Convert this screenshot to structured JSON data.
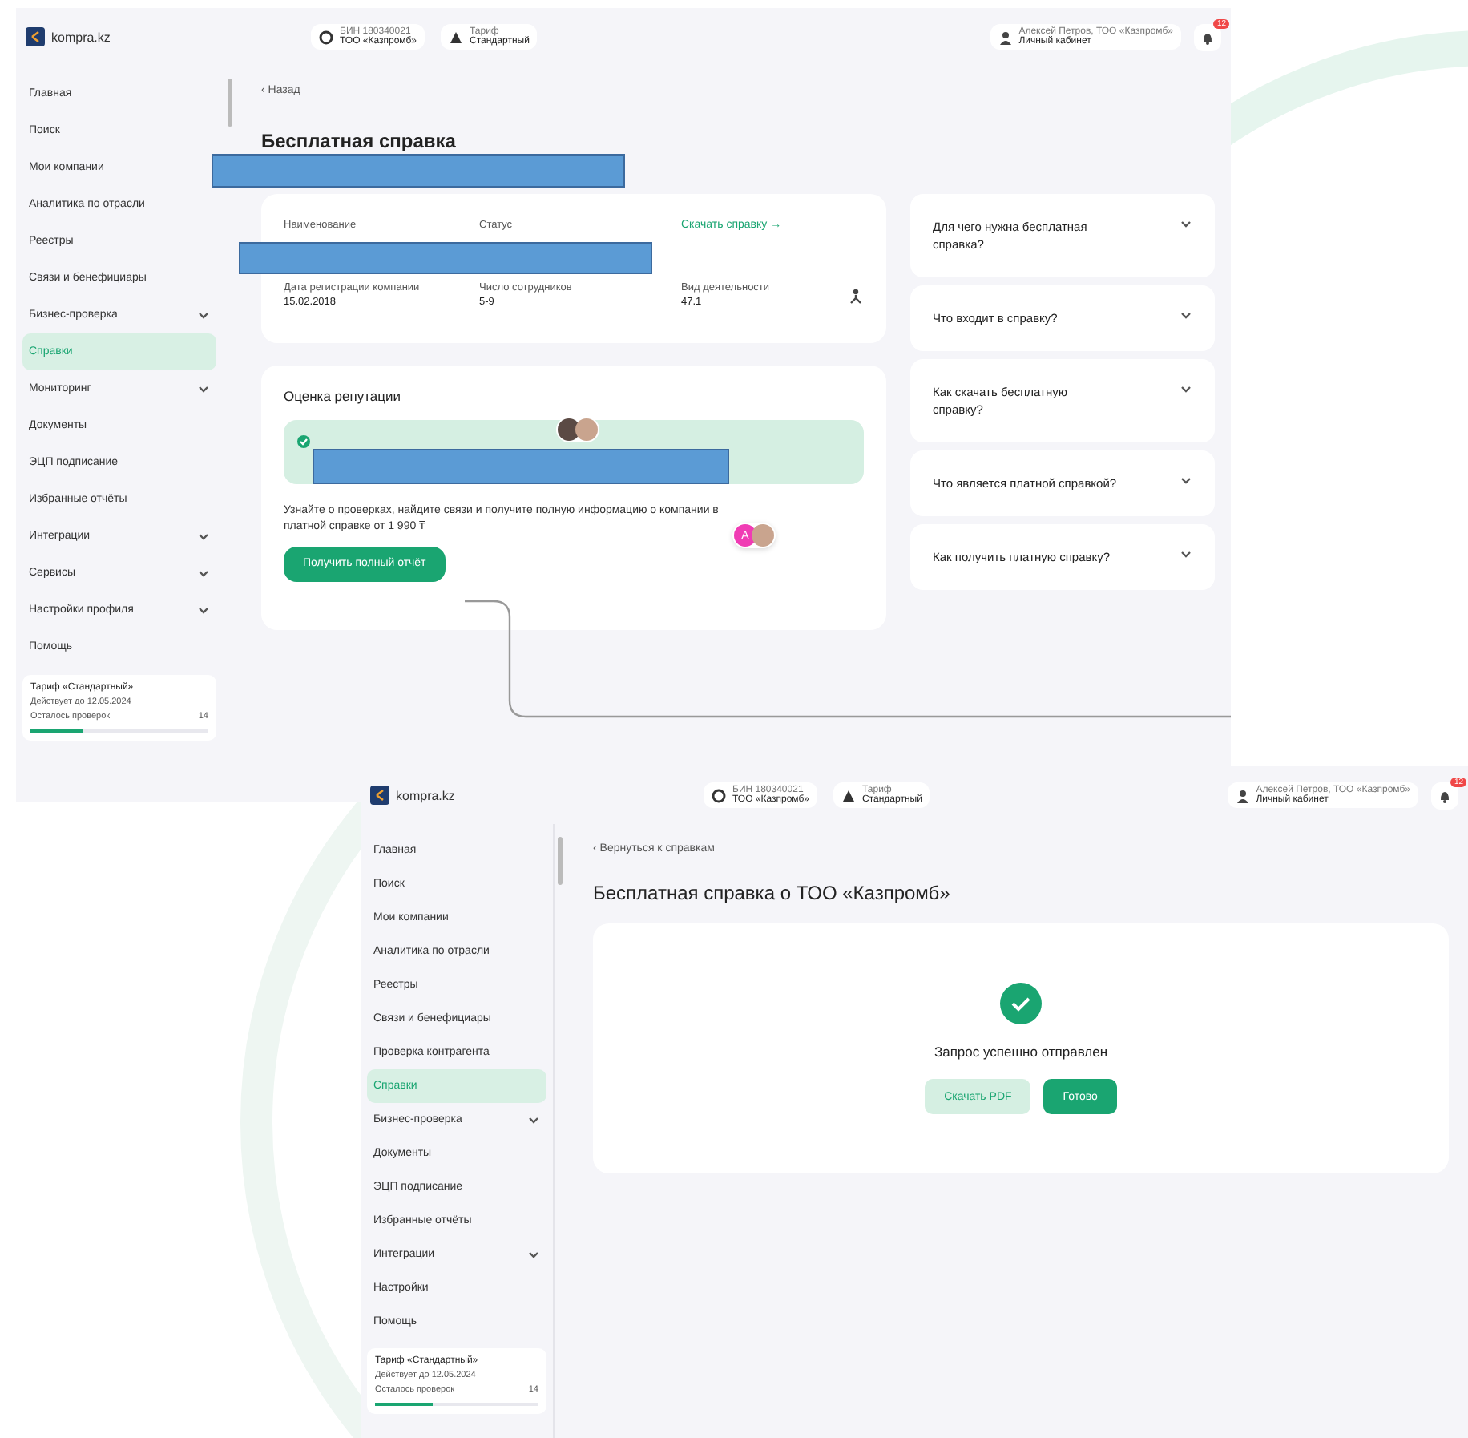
{
  "windows": [
    {
      "header": {
        "logo": "kompra.kz",
        "pills": [
          {
            "line1": "БИН 180340021",
            "line2": "ТОО «Казпромб»"
          },
          {
            "line1": "Тариф",
            "line2": "Стандартный"
          }
        ],
        "user": {
          "line1": "Алексей Петров, ТОО «Казпромб»",
          "line2": "Личный кабинет"
        },
        "badge": "12"
      },
      "sidebar": {
        "items": [
          {
            "label": "Главная",
            "selected": false,
            "has_children": false
          },
          {
            "label": "Поиск",
            "selected": false,
            "has_children": false
          },
          {
            "label": "Мои компании",
            "selected": false,
            "has_children": false
          },
          {
            "label": "Аналитика по отрасли",
            "selected": false,
            "has_children": false
          },
          {
            "label": "Реестры",
            "selected": false,
            "has_children": false
          },
          {
            "label": "Связи и бенефициары",
            "selected": false,
            "has_children": false
          },
          {
            "label": "Бизнес-проверка",
            "selected": false,
            "has_children": true
          },
          {
            "label": "Справки",
            "selected": true,
            "has_children": false
          },
          {
            "label": "Мониторинг",
            "selected": false,
            "has_children": true
          },
          {
            "label": "Документы",
            "selected": false,
            "has_children": false
          },
          {
            "label": "ЭЦП подписание",
            "selected": false,
            "has_children": false
          },
          {
            "label": "Избранные отчёты",
            "selected": false,
            "has_children": false
          },
          {
            "label": "Интеграции",
            "selected": false,
            "has_children": true
          },
          {
            "label": "Сервисы",
            "selected": false,
            "has_children": true
          },
          {
            "label": "Настройки профиля",
            "selected": false,
            "has_children": true
          },
          {
            "label": "Помощь",
            "selected": false,
            "has_children": false
          }
        ],
        "plan": {
          "title": "Тариф «Стандартный»",
          "text": "Действует до 12.05.2024",
          "label": "Осталось проверок",
          "count": "14",
          "level": 0.3
        }
      },
      "main": {
        "back": "‹ Назад",
        "title": "Бесплатная справка",
        "summary": {
          "labels": [
            "Наименование",
            "Статус"
          ],
          "link": "Скачать справку →",
          "fields": [
            {
              "label": "Дата регистрации компании",
              "value": "15.02.2018"
            },
            {
              "label": "Число сотрудников",
              "value": "5-9"
            },
            {
              "label": "Вид деятельности",
              "value": "47.1"
            }
          ]
        },
        "reputation": {
          "title": "Оценка репутации",
          "badge_letter": "А",
          "text": "Узнайте о проверках, найдите связи и получите полную информацию о компании в платной справке от 1 990 ₸",
          "button": "Получить полный отчёт"
        },
        "faq": [
          "Для чего нужна бесплатная справка?",
          "Что входит в справку?",
          "Как скачать бесплатную справку?",
          "Что является платной справкой?",
          "Как получить платную справку?"
        ]
      }
    },
    {
      "header": {
        "logo": "kompra.kz",
        "pills": [
          {
            "line1": "БИН 180340021",
            "line2": "ТОО «Казпромб»"
          },
          {
            "line1": "Тариф",
            "line2": "Стандартный"
          }
        ],
        "user": {
          "line1": "Алексей Петров, ТОО «Казпромб»",
          "line2": "Личный кабинет"
        },
        "badge": "12"
      },
      "sidebar": {
        "items": [
          {
            "label": "Главная",
            "selected": false,
            "has_children": false
          },
          {
            "label": "Поиск",
            "selected": false,
            "has_children": false
          },
          {
            "label": "Мои компании",
            "selected": false,
            "has_children": false
          },
          {
            "label": "Аналитика по отрасли",
            "selected": false,
            "has_children": false
          },
          {
            "label": "Реестры",
            "selected": false,
            "has_children": false
          },
          {
            "label": "Связи и бенефициары",
            "selected": false,
            "has_children": false
          },
          {
            "label": "Проверка контрагента",
            "selected": false,
            "has_children": false
          },
          {
            "label": "Справки",
            "selected": true,
            "has_children": false
          },
          {
            "label": "Бизнес-проверка",
            "selected": false,
            "has_children": true
          },
          {
            "label": "Документы",
            "selected": false,
            "has_children": false
          },
          {
            "label": "ЭЦП подписание",
            "selected": false,
            "has_children": false
          },
          {
            "label": "Избранные отчёты",
            "selected": false,
            "has_children": false
          },
          {
            "label": "Интеграции",
            "selected": false,
            "has_children": true
          },
          {
            "label": "Настройки",
            "selected": false,
            "has_children": false
          },
          {
            "label": "Помощь",
            "selected": false,
            "has_children": false
          }
        ],
        "plan": {
          "title": "Тариф «Стандартный»",
          "text": "Действует до 12.05.2024",
          "label": "Осталось проверок",
          "count": "14",
          "level": 0.35
        }
      },
      "main": {
        "back": "‹ Вернуться к справкам",
        "title": "Бесплатная справка о ТОО «Казпромб»",
        "message": "Запрос успешно отправлен",
        "buttons": [
          {
            "label": "Скачать PDF",
            "kind": "secondary"
          },
          {
            "label": "Готово",
            "kind": "primary"
          }
        ]
      }
    }
  ]
}
